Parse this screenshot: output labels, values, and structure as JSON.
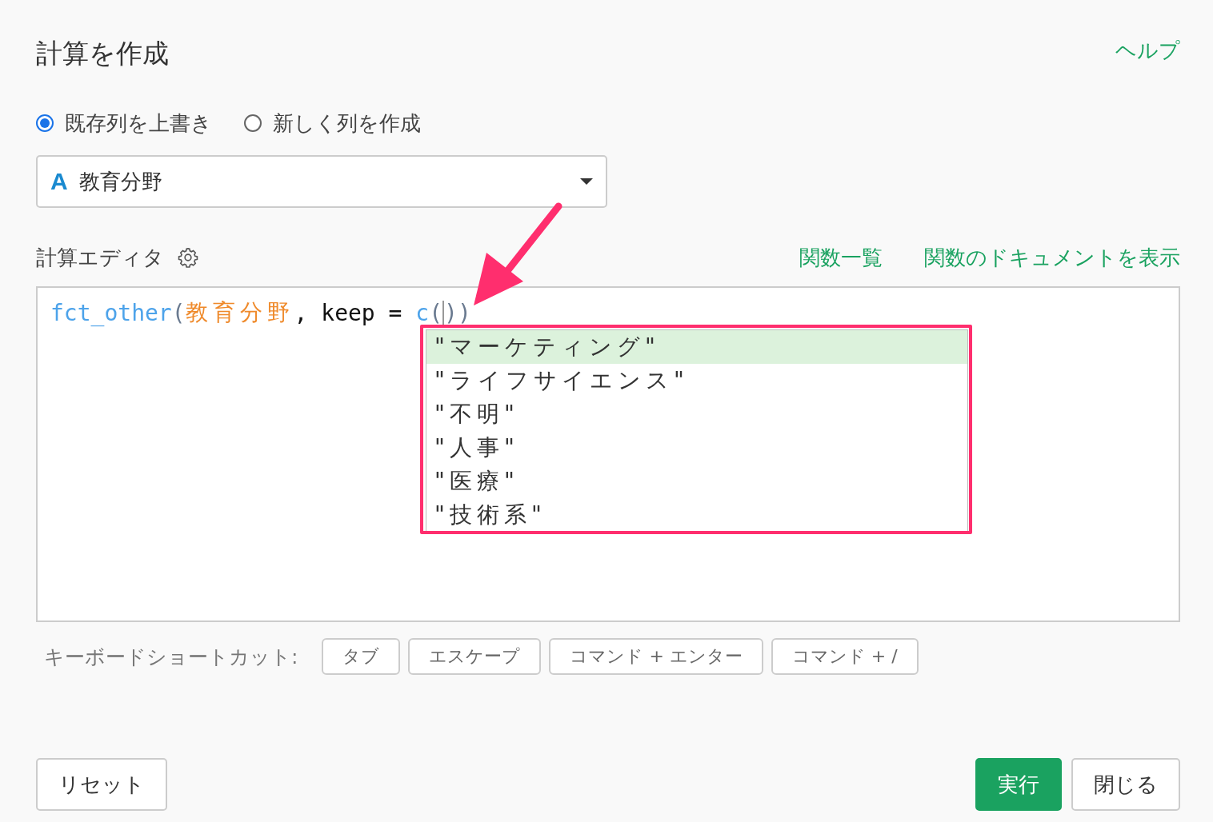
{
  "dialog": {
    "title": "計算を作成",
    "help_link": "ヘルプ"
  },
  "mode_options": [
    {
      "label": "既存列を上書き",
      "selected": true
    },
    {
      "label": "新しく列を作成",
      "selected": false
    }
  ],
  "column_select": {
    "type_icon": "A",
    "value": "教育分野"
  },
  "editor": {
    "label": "計算エディタ",
    "links": [
      "関数一覧",
      "関数のドキュメントを表示"
    ],
    "code": [
      {
        "text": "fct_other",
        "kind": "function"
      },
      {
        "text": "(",
        "kind": "paren"
      },
      {
        "text": "教育分野",
        "kind": "column"
      },
      {
        "text": ", keep = ",
        "kind": "plain"
      },
      {
        "text": "c",
        "kind": "function"
      },
      {
        "text": "(",
        "kind": "paren"
      },
      {
        "text": ")",
        "kind": "paren",
        "cursor_before": true
      },
      {
        "text": ")",
        "kind": "paren"
      }
    ],
    "suggestions": [
      {
        "text": "\"マーケティング\"",
        "selected": true
      },
      {
        "text": "\"ライフサイエンス\"",
        "selected": false
      },
      {
        "text": "\"不明\"",
        "selected": false
      },
      {
        "text": "\"人事\"",
        "selected": false
      },
      {
        "text": "\"医療\"",
        "selected": false
      },
      {
        "text": "\"技術系\"",
        "selected": false
      }
    ]
  },
  "shortcuts": {
    "label": "キーボードショートカット:",
    "keys": [
      "タブ",
      "エスケープ",
      "コマンド + エンター",
      "コマンド + /"
    ]
  },
  "footer": {
    "reset": "リセット",
    "run": "実行",
    "close": "閉じる"
  }
}
